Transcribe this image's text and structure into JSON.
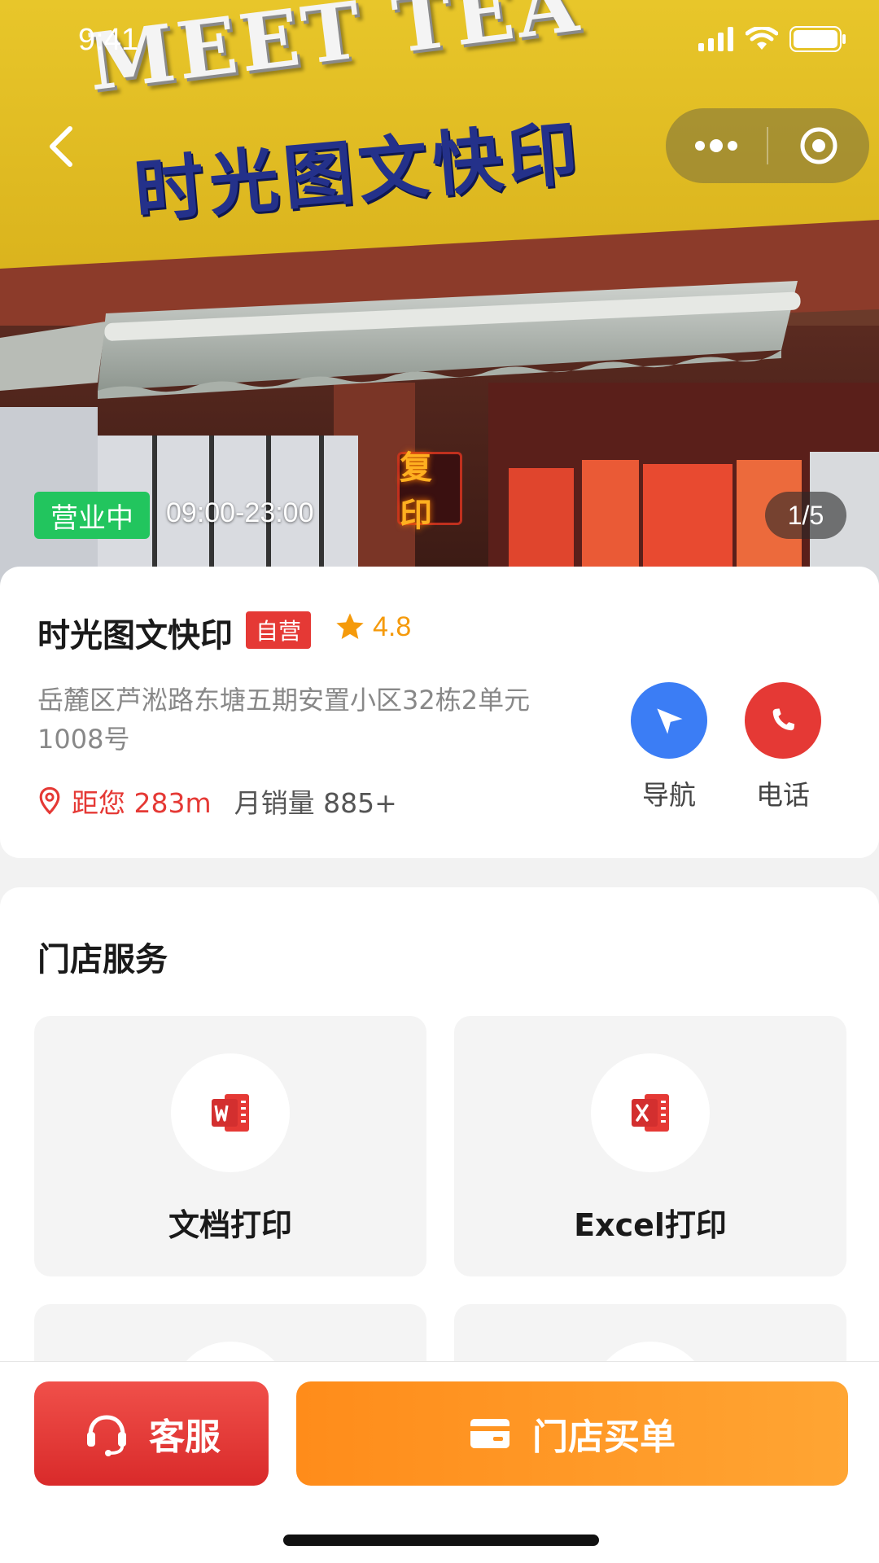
{
  "status_bar": {
    "time": "9:41"
  },
  "hero": {
    "sign_english": "MEET TEA",
    "sign_chinese": "时光图文快印",
    "neon_sign": "复印",
    "open_status": "营业中",
    "hours": "09:00-23:00",
    "photo_counter": "1/5"
  },
  "store": {
    "name": "时光图文快印",
    "tag": "自营",
    "rating": "4.8",
    "address": "岳麓区芦淞路东塘五期安置小区32栋2单元1008号",
    "distance": "距您 283m",
    "monthly_sales": "月销量 885+",
    "actions": {
      "navigate": "导航",
      "call": "电话"
    }
  },
  "services": {
    "title": "门店服务",
    "items": [
      {
        "label": "文档打印",
        "icon": "word-icon"
      },
      {
        "label": "Excel打印",
        "icon": "excel-icon"
      }
    ]
  },
  "bottom_bar": {
    "customer_service": "客服",
    "store_pay": "门店买单"
  },
  "colors": {
    "open_green": "#22c55e",
    "brand_red": "#e53935",
    "nav_blue": "#3b7df5",
    "rating_orange": "#f59a0b",
    "pay_orange": "#ff8c1a"
  }
}
